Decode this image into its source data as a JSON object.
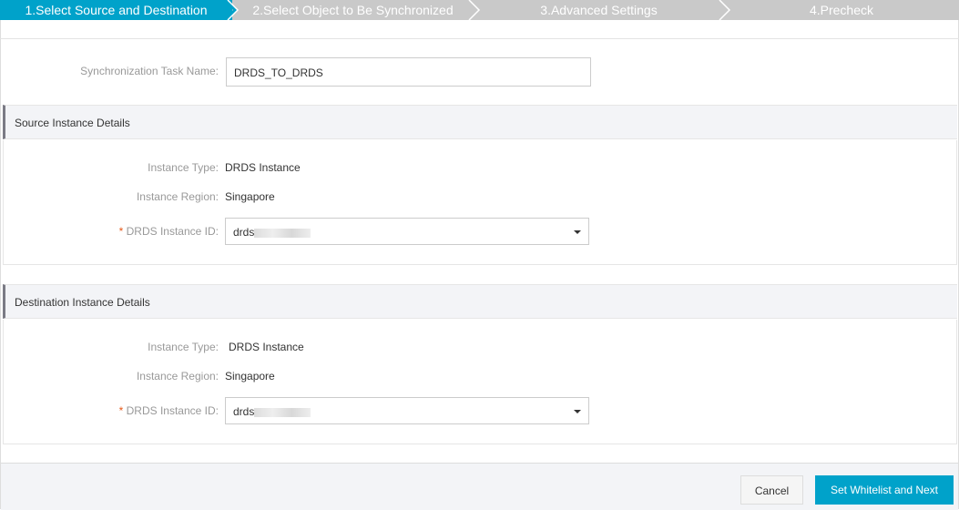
{
  "steps": [
    "1.Select Source and Destination",
    "2.Select Object to Be Synchronized",
    "3.Advanced Settings",
    "4.Precheck"
  ],
  "task": {
    "label": "Synchronization Task Name:",
    "value": "DRDS_TO_DRDS"
  },
  "source": {
    "title": "Source Instance Details",
    "type_label": "Instance Type:",
    "type_value": "DRDS Instance",
    "region_label": "Instance Region:",
    "region_value": "Singapore",
    "id_label": "DRDS Instance ID:",
    "id_value": "drds",
    "required": "*"
  },
  "destination": {
    "title": "Destination Instance Details",
    "type_label": "Instance Type:",
    "type_value": "DRDS Instance",
    "region_label": "Instance Region:",
    "region_value": "Singapore",
    "id_label": "DRDS Instance ID:",
    "id_value": "drds",
    "required": "*"
  },
  "footer": {
    "cancel": "Cancel",
    "next": "Set Whitelist and Next"
  },
  "colors": {
    "accent": "#00a2ca",
    "step_inactive": "#c9c9c9"
  }
}
